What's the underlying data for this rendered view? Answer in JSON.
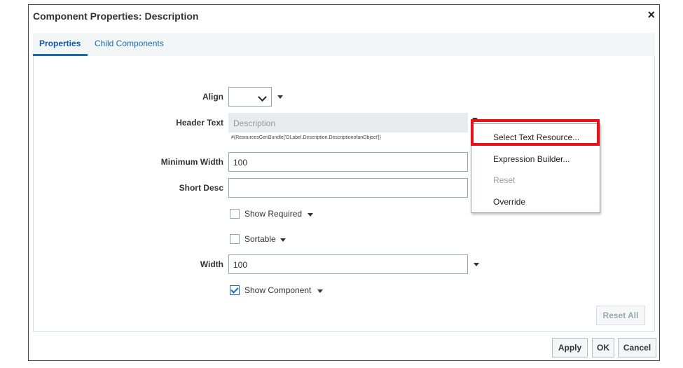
{
  "dialog": {
    "title": "Component Properties: Description",
    "close_glyph": "×"
  },
  "tabs": [
    {
      "label": "Properties",
      "active": true
    },
    {
      "label": "Child Components",
      "active": false
    }
  ],
  "form": {
    "align": {
      "label": "Align",
      "value": ""
    },
    "header_text": {
      "label": "Header Text",
      "value": "Description",
      "hint": "#{ResourcesGenBundle['OLabel.Description.DescriptionofanObject']}"
    },
    "minimum_width": {
      "label": "Minimum Width",
      "value": "100"
    },
    "short_desc": {
      "label": "Short Desc",
      "value": ""
    },
    "show_required": {
      "label": "Show Required",
      "checked": false
    },
    "sortable": {
      "label": "Sortable",
      "checked": false
    },
    "width": {
      "label": "Width",
      "value": "100"
    },
    "show_component": {
      "label": "Show Component",
      "checked": true
    }
  },
  "context_menu": {
    "items": [
      {
        "label": "Select Text Resource...",
        "enabled": true,
        "highlighted": true
      },
      {
        "label": "Expression Builder...",
        "enabled": true
      },
      {
        "label": "Reset",
        "enabled": false
      },
      {
        "label": "Override",
        "enabled": true
      }
    ]
  },
  "buttons": {
    "reset_all": "Reset All",
    "apply": "Apply",
    "ok": "OK",
    "cancel": "Cancel"
  },
  "colors": {
    "accent": "#1a6bb0",
    "highlight_border": "#e8101a"
  }
}
